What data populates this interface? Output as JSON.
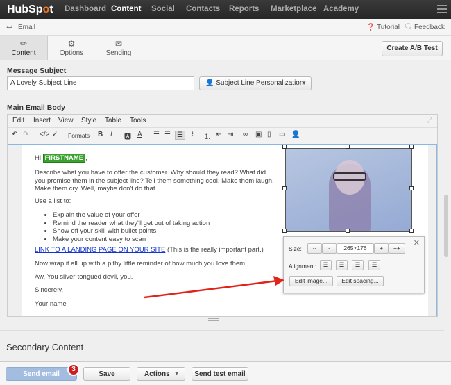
{
  "nav": {
    "logo": "HubSpot",
    "items": [
      "Dashboard",
      "Content",
      "Social",
      "Contacts",
      "Reports",
      "Marketplace",
      "Academy"
    ],
    "active": "Content"
  },
  "subheader": {
    "back": "Email",
    "tutorial": "Tutorial",
    "feedback": "Feedback"
  },
  "tabs": [
    {
      "label": "Content",
      "icon": "pencil-icon"
    },
    {
      "label": "Options",
      "icon": "gear-icon"
    },
    {
      "label": "Sending",
      "icon": "envelope-download-icon"
    }
  ],
  "ab_button": "Create A/B Test",
  "subject": {
    "label": "Message Subject",
    "value": "A Lovely Subject Line",
    "personalization": "Subject Line Personalization"
  },
  "body_label": "Main Email Body",
  "editor": {
    "menu": [
      "Edit",
      "Insert",
      "View",
      "Style",
      "Table",
      "Tools"
    ],
    "formats": "Formats"
  },
  "email": {
    "hi": "Hi",
    "token": "FIRSTNAME",
    "para1": "Describe what you have to offer the customer. Why should they read? What did you promise them in the subject line? Tell them something cool. Make them laugh. Make them cry. Well, maybe don't do that...",
    "list_intro": "Use a list to:",
    "list": [
      "Explain the value of your offer",
      "Remind the reader what they'll get out of taking action",
      "Show off your skill with bullet points",
      "Make your content easy to scan"
    ],
    "link": "LINK TO A LANDING PAGE ON YOUR SITE",
    "link_after": " (This is the really important part.)",
    "para2": "Now wrap it all up with a pithy little reminder of how much you love them.",
    "para3": "Aw. You silver-tongued devil, you.",
    "sign": "Sincerely,",
    "name": "Your name"
  },
  "image_popup": {
    "size_label": "Size:",
    "size_buttons": [
      "--",
      "-",
      "265×176",
      "+",
      "++"
    ],
    "alignment_label": "Alignment:",
    "edit_image": "Edit image...",
    "edit_spacing": "Edit spacing..."
  },
  "secondary": "Secondary Content",
  "footer": {
    "send": "Send email",
    "badge": "3",
    "save": "Save",
    "actions": "Actions",
    "test": "Send test email"
  },
  "colors": {
    "accent": "#f57722",
    "token": "#3ba12e",
    "badge": "#cc1f1f",
    "send": "#a3bde0"
  }
}
